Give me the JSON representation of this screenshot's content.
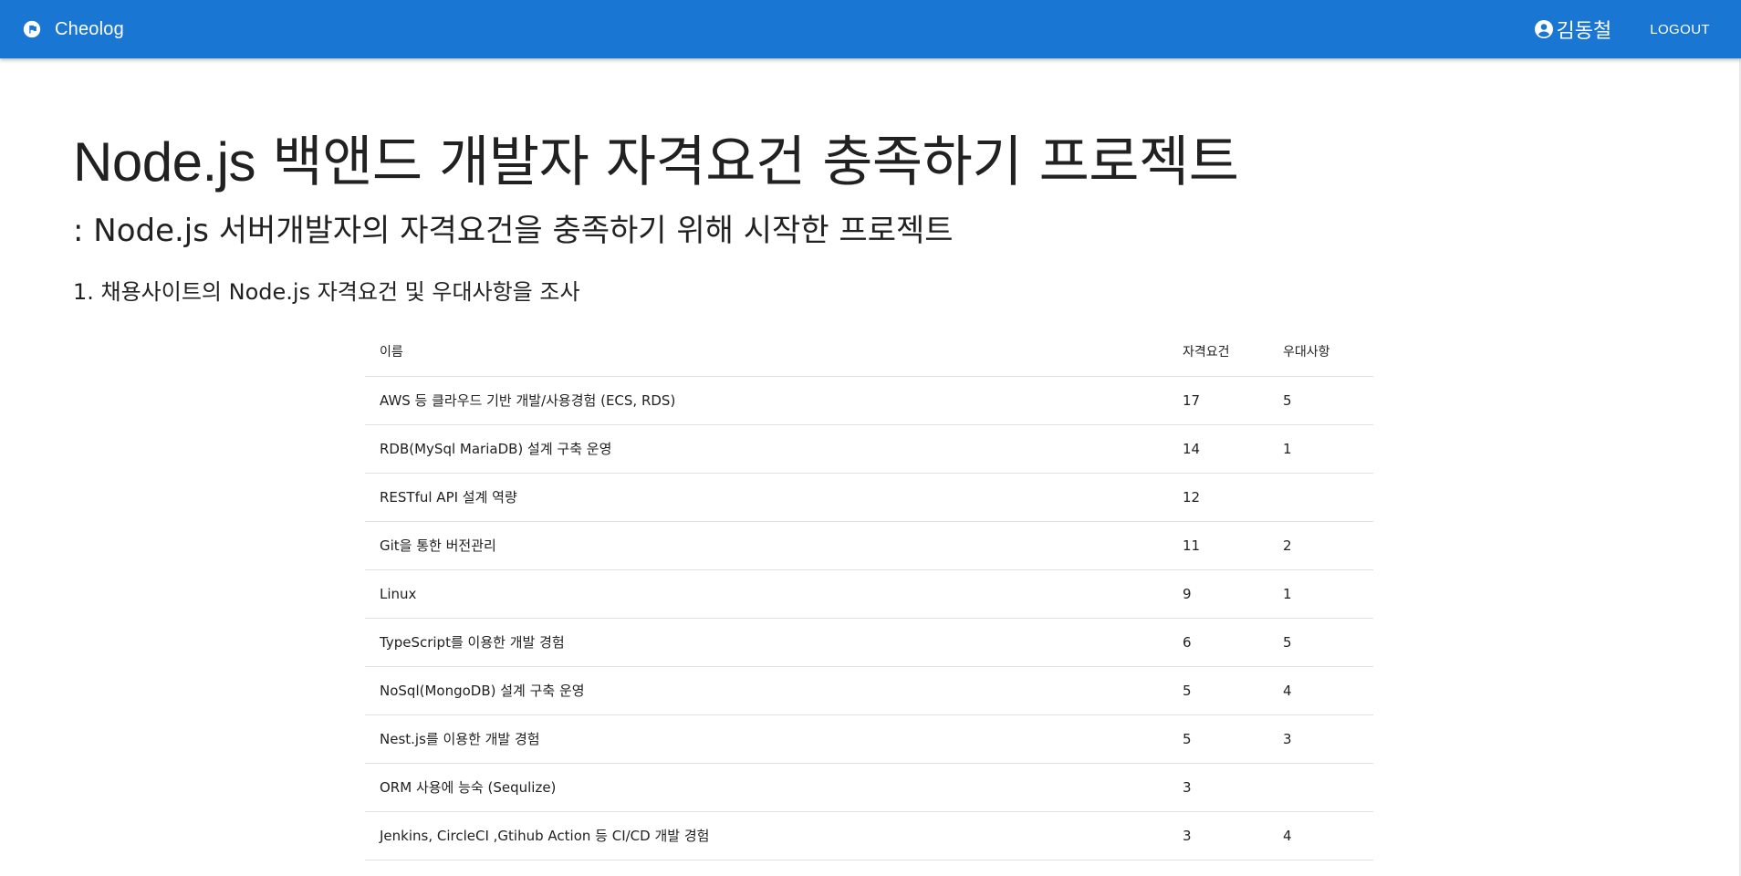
{
  "appbar": {
    "brand_icon": "flag-circle-icon",
    "brand_name": "Cheolog",
    "user_icon": "account-circle-icon",
    "user_name": "김동철",
    "logout_label": "LOGOUT",
    "color": "#1976d2"
  },
  "page": {
    "title_latin": "Node.js",
    "title_rest": " 백앤드 개발자 자격요건 충족하기 프로젝트",
    "subtitle": ": Node.js 서버개발자의 자격요건을 충족하기 위해 시작한 프로젝트",
    "section_heading": "1. 채용사이트의 Node.js 자격요건 및 우대사항을 조사"
  },
  "table": {
    "headers": [
      "이름",
      "자격요건",
      "우대사항"
    ],
    "rows": [
      {
        "name": "AWS 등 클라우드 기반 개발/사용경험 (ECS, RDS)",
        "req": "17",
        "pref": "5"
      },
      {
        "name": "RDB(MySql MariaDB) 설계 구축 운영",
        "req": "14",
        "pref": "1"
      },
      {
        "name": "RESTful API 설계 역량",
        "req": "12",
        "pref": ""
      },
      {
        "name": "Git을 통한 버전관리",
        "req": "11",
        "pref": "2"
      },
      {
        "name": "Linux",
        "req": "9",
        "pref": "1"
      },
      {
        "name": "TypeScript를 이용한 개발 경험",
        "req": "6",
        "pref": "5"
      },
      {
        "name": "NoSql(MongoDB) 설계 구축 운영",
        "req": "5",
        "pref": "4"
      },
      {
        "name": "Nest.js를 이용한 개발 경험",
        "req": "5",
        "pref": "3"
      },
      {
        "name": "ORM 사용에 능숙 (Sequlize)",
        "req": "3",
        "pref": ""
      },
      {
        "name": "Jenkins, CircleCI ,Gtihub Action 등 CI/CD 개발 경험",
        "req": "3",
        "pref": "4"
      }
    ]
  }
}
